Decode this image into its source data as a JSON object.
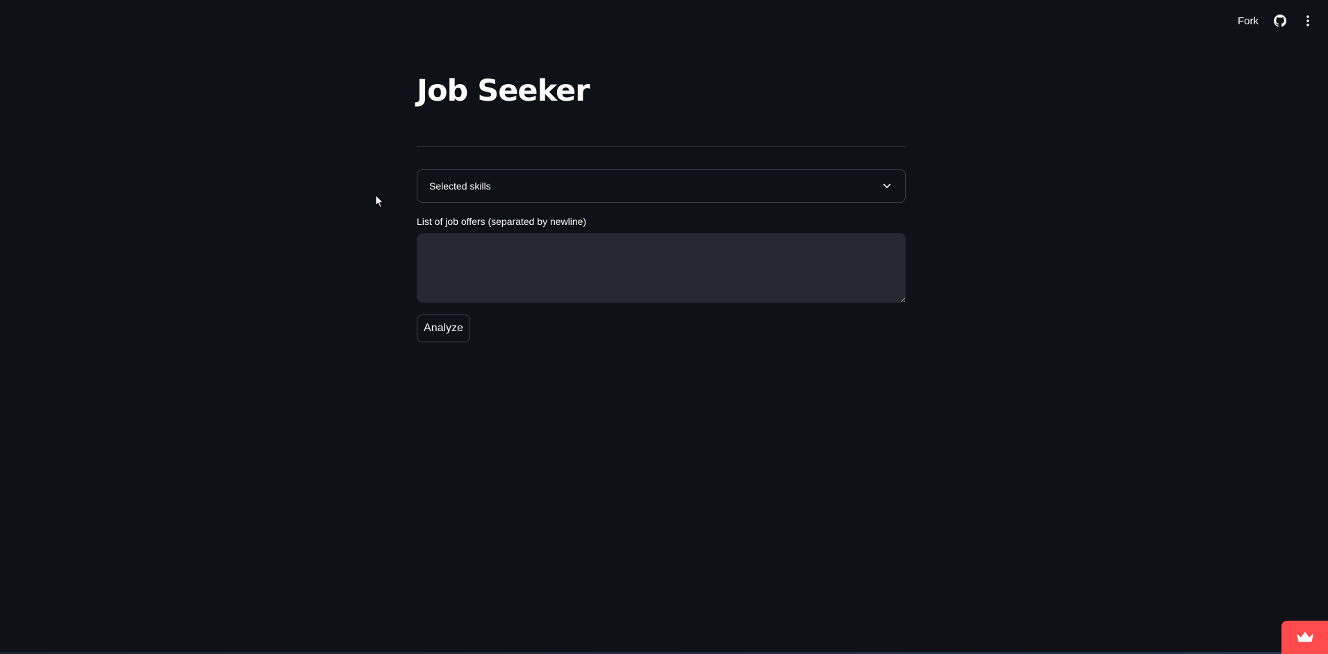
{
  "toolbar": {
    "fork_label": "Fork",
    "github_icon": "github-icon",
    "menu_icon": "kebab-menu-icon"
  },
  "main": {
    "title": "Job Seeker",
    "skills_select": {
      "placeholder": "Selected skills",
      "icon": "chevron-down-icon"
    },
    "job_offers": {
      "label": "List of job offers (separated by newline)",
      "value": ""
    },
    "analyze_button": "Analyze"
  },
  "badge": {
    "icon": "crown-icon",
    "color": "#ff4b4b"
  },
  "colors": {
    "background": "#0e1117",
    "input_background": "#262730",
    "border": "#3d4049",
    "text": "#fafafa"
  }
}
